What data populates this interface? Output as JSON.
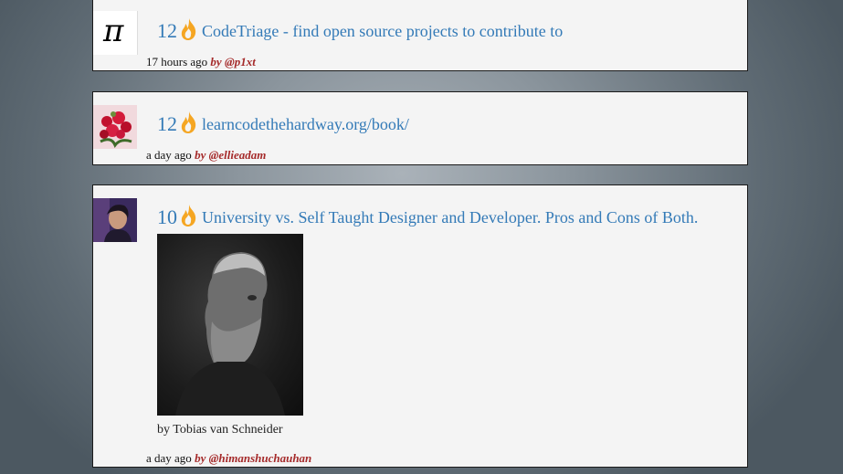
{
  "posts": [
    {
      "score": "12",
      "title": "CodeTriage - find open source projects to contribute to",
      "time": "17 hours ago",
      "author": "by @p1xt",
      "avatar_icon": "pi-symbol-icon",
      "avatar_glyph": "π"
    },
    {
      "score": "12",
      "title": "learncodethehardway.org/book/",
      "time": "a day ago",
      "author": "by @ellieadam",
      "avatar_icon": "flowers-avatar-icon"
    },
    {
      "score": "10",
      "title": "University vs. Self Taught Designer and Developer. Pros and Cons of Both.",
      "time": "a day ago",
      "author": "by @himanshuchauhan",
      "avatar_icon": "person-avatar-icon",
      "image_caption": "by Tobias van Schneider"
    }
  ],
  "icons": {
    "score_icon": "flame-icon"
  },
  "colors": {
    "link": "#337ab7",
    "author": "#a52a2a",
    "card_bg": "#f4f4f4",
    "flame": "#f5a623"
  }
}
